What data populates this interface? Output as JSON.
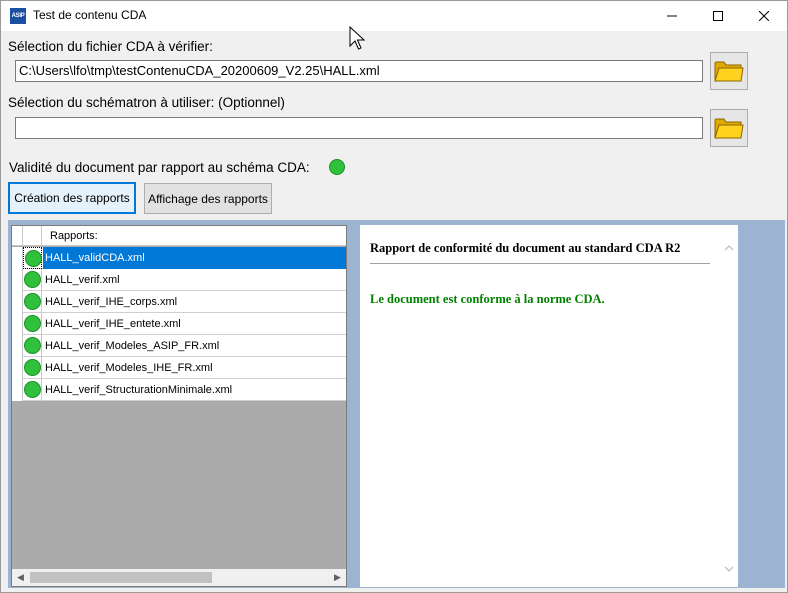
{
  "window": {
    "title": "Test de contenu CDA",
    "icon_label": "ASIP"
  },
  "cda_file": {
    "label": "Sélection du fichier CDA à vérifier:",
    "value": "C:\\Users\\lfo\\tmp\\testContenuCDA_20200609_V2.25\\HALL.xml"
  },
  "schematron": {
    "label": "Sélection du schématron à utiliser: (Optionnel)",
    "value": ""
  },
  "validity": {
    "label": "Validité du document par rapport au schéma CDA:",
    "status_color": "#2fc13b"
  },
  "buttons": {
    "create_reports": "Création des rapports",
    "show_reports": "Affichage des rapports"
  },
  "reports_grid": {
    "column_header": "Rapports:",
    "rows": [
      {
        "name": "HALL_validCDA.xml",
        "status_color": "#2fc13b",
        "selected": true
      },
      {
        "name": "HALL_verif.xml",
        "status_color": "#2fc13b",
        "selected": false
      },
      {
        "name": "HALL_verif_IHE_corps.xml",
        "status_color": "#2fc13b",
        "selected": false
      },
      {
        "name": "HALL_verif_IHE_entete.xml",
        "status_color": "#2fc13b",
        "selected": false
      },
      {
        "name": "HALL_verif_Modeles_ASIP_FR.xml",
        "status_color": "#2fc13b",
        "selected": false
      },
      {
        "name": "HALL_verif_Modeles_IHE_FR.xml",
        "status_color": "#2fc13b",
        "selected": false
      },
      {
        "name": "HALL_verif_StructurationMinimale.xml",
        "status_color": "#2fc13b",
        "selected": false
      }
    ]
  },
  "report": {
    "title": "Rapport de conformité du document au standard CDA R2",
    "message": "Le document est conforme à la norme CDA.",
    "message_color": "#008000"
  },
  "colors": {
    "selection": "#0078d7",
    "panel_background": "#9cb3d1"
  }
}
